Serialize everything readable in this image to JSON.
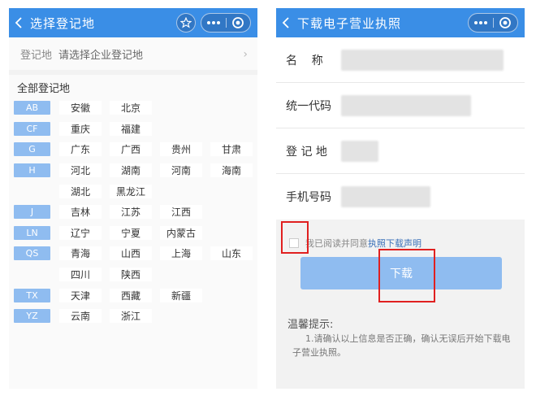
{
  "left": {
    "nav_title": "选择登记地",
    "reg_label": "登记地",
    "reg_placeholder": "请选择企业登记地",
    "all_title": "全部登记地",
    "rows": [
      {
        "letter": "AB",
        "provinces": [
          "安徽",
          "北京"
        ]
      },
      {
        "letter": "CF",
        "provinces": [
          "重庆",
          "福建"
        ]
      },
      {
        "letter": "G",
        "provinces": [
          "广东",
          "广西",
          "贵州",
          "甘肃"
        ]
      },
      {
        "letter": "H",
        "provinces": [
          "河北",
          "湖南",
          "河南",
          "海南"
        ]
      },
      {
        "letter": "",
        "provinces": [
          "湖北",
          "黑龙江"
        ]
      },
      {
        "letter": "J",
        "provinces": [
          "吉林",
          "江苏",
          "江西"
        ]
      },
      {
        "letter": "LN",
        "provinces": [
          "辽宁",
          "宁夏",
          "内蒙古"
        ]
      },
      {
        "letter": "QS",
        "provinces": [
          "青海",
          "山西",
          "上海",
          "山东"
        ]
      },
      {
        "letter": "",
        "provinces": [
          "四川",
          "陕西"
        ]
      },
      {
        "letter": "TX",
        "provinces": [
          "天津",
          "西藏",
          "新疆"
        ]
      },
      {
        "letter": "YZ",
        "provinces": [
          "云南",
          "浙江"
        ]
      }
    ]
  },
  "right": {
    "nav_title": "下载电子营业执照",
    "fields": [
      {
        "label": "名    称"
      },
      {
        "label": "统一代码"
      },
      {
        "label": "登 记 地"
      },
      {
        "label": "手机号码"
      }
    ],
    "agree_text": "我已阅读并同意",
    "agree_link": "执照下载声明",
    "download_label": "下载",
    "tip_title": "温馨提示:",
    "tip_text": "1.请确认以上信息是否正确，确认无误后开始下载电子营业执照。"
  },
  "colors": {
    "nav_blue": "#3a8ee6",
    "button_light_blue": "#8fbcf0",
    "highlight_red": "#e02020"
  }
}
